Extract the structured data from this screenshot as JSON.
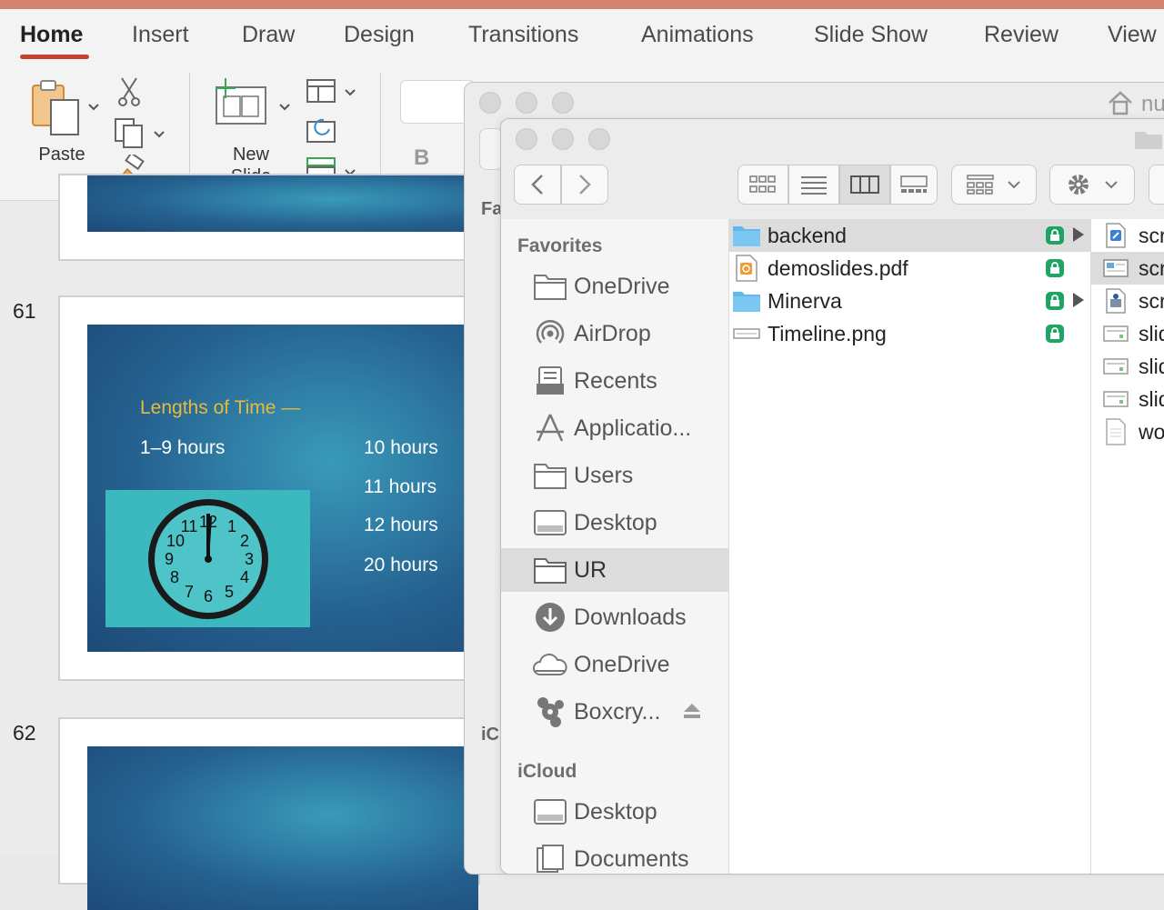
{
  "ppt": {
    "tabs": [
      "Home",
      "Insert",
      "Draw",
      "Design",
      "Transitions",
      "Animations",
      "Slide Show",
      "Review",
      "View"
    ],
    "ribbon": {
      "paste_label": "Paste",
      "new_slide_line1": "New",
      "new_slide_line2": "Slide",
      "bold_label": "B"
    },
    "slides": [
      {
        "number": "61"
      },
      {
        "number": "62"
      }
    ],
    "slide61": {
      "title": "Lengths of Time —",
      "left_item": "1–9 hours",
      "right_items": [
        "10 hours",
        "11 hours",
        "12 hours",
        "20 hours"
      ],
      "clock_numbers": [
        "12",
        "1",
        "2",
        "3",
        "4",
        "5",
        "6",
        "7",
        "8",
        "9",
        "10",
        "11"
      ]
    }
  },
  "finder_back": {
    "path_fragment": "nu",
    "sidebar_fragments": [
      "Fa",
      "iC"
    ]
  },
  "finder": {
    "sidebar": {
      "favorites_header": "Favorites",
      "favorites": [
        {
          "label": "OneDrive",
          "icon": "folder-icon"
        },
        {
          "label": "AirDrop",
          "icon": "airdrop-icon"
        },
        {
          "label": "Recents",
          "icon": "recents-icon"
        },
        {
          "label": "Applicatio...",
          "icon": "applications-icon"
        },
        {
          "label": "Users",
          "icon": "folder-icon"
        },
        {
          "label": "Desktop",
          "icon": "desktop-icon"
        },
        {
          "label": "UR",
          "icon": "folder-icon"
        },
        {
          "label": "Downloads",
          "icon": "downloads-icon"
        },
        {
          "label": "OneDrive",
          "icon": "cloud-icon"
        },
        {
          "label": "Boxcry...",
          "icon": "boxcryptor-icon"
        }
      ],
      "icloud_header": "iCloud",
      "icloud": [
        {
          "label": "Desktop",
          "icon": "desktop-icon"
        },
        {
          "label": "Documents",
          "icon": "documents-icon"
        }
      ]
    },
    "column1": [
      {
        "name": "backend",
        "type": "folder",
        "locked": true,
        "has_children": true
      },
      {
        "name": "demoslides.pdf",
        "type": "pdf",
        "locked": true,
        "has_children": false
      },
      {
        "name": "Minerva",
        "type": "folder",
        "locked": true,
        "has_children": true
      },
      {
        "name": "Timeline.png",
        "type": "image",
        "locked": true,
        "has_children": false
      }
    ],
    "column2": [
      {
        "name": "scr",
        "type": "script"
      },
      {
        "name": "scr",
        "type": "screenshot"
      },
      {
        "name": "scr",
        "type": "script2"
      },
      {
        "name": "slid",
        "type": "slide"
      },
      {
        "name": "slid",
        "type": "slide"
      },
      {
        "name": "slid",
        "type": "slide"
      },
      {
        "name": "wo",
        "type": "document"
      }
    ],
    "colors": {
      "selection": "#dcdcdc",
      "lock_badge": "#1fa463",
      "folder_blue": "#5fb8ee"
    }
  }
}
